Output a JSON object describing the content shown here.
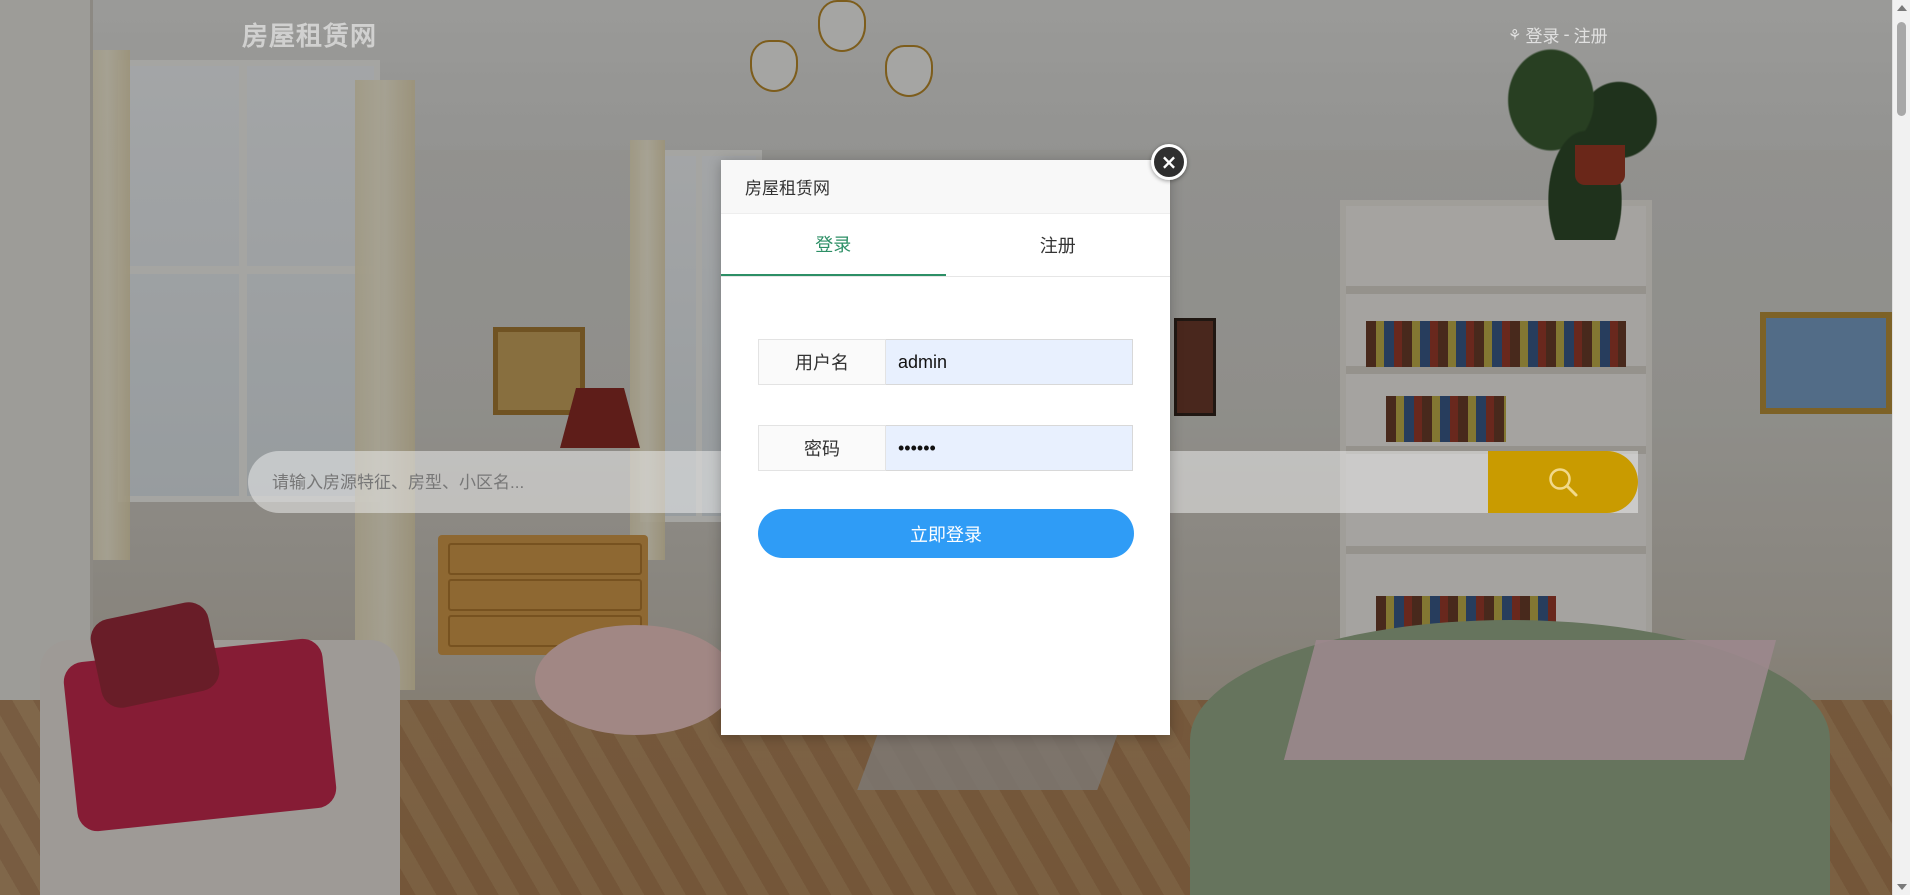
{
  "site": {
    "logo": "房屋租赁网",
    "login_link": "登录",
    "separator": "-",
    "register_link": "注册"
  },
  "search": {
    "placeholder": "请输入房源特征、房型、小区名...",
    "button_icon": "search-icon"
  },
  "modal": {
    "title": "房屋租赁网",
    "close_icon": "close-icon",
    "tabs": [
      {
        "label": "登录",
        "active": true
      },
      {
        "label": "注册",
        "active": false
      }
    ],
    "fields": {
      "username_label": "用户名",
      "username_value": "admin",
      "password_label": "密码",
      "password_value": "......"
    },
    "submit_label": "立即登录"
  },
  "colors": {
    "accent_tab": "#2d8f66",
    "primary_button": "#2f9cf6",
    "search_button": "#c99b00",
    "autofill_bg": "#e8f0fe"
  }
}
